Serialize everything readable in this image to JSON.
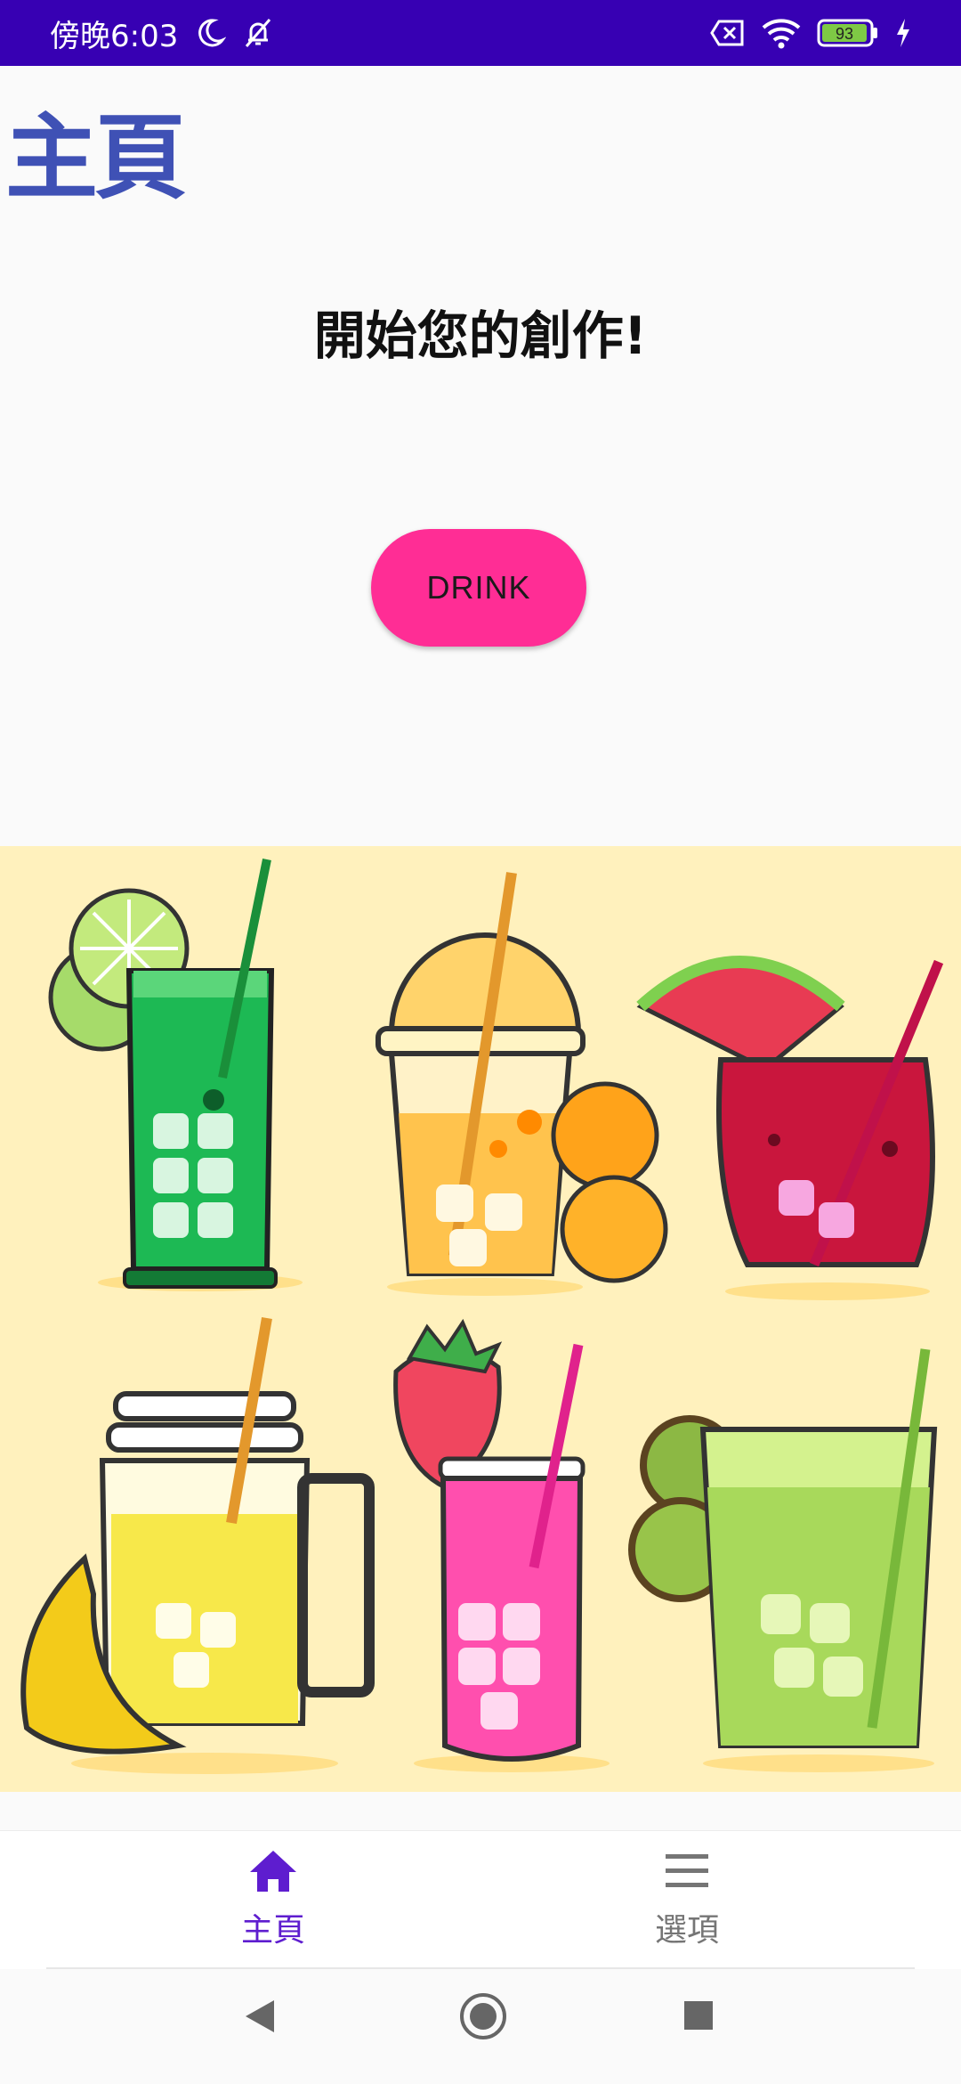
{
  "status_bar": {
    "time": "傍晚6:03",
    "battery": "93",
    "icons": [
      "moon-icon",
      "bell-off-icon",
      "sim-off-icon",
      "wifi-icon",
      "battery-icon",
      "charging-icon"
    ]
  },
  "page": {
    "title": "主頁",
    "headline": "開始您的創作!",
    "button_label": "DRINK"
  },
  "illustration": {
    "name": "drinks-illustration"
  },
  "bottom_nav": {
    "items": [
      {
        "label": "主頁",
        "icon": "home-icon",
        "selected": true
      },
      {
        "label": "選項",
        "icon": "menu-icon",
        "selected": false
      }
    ]
  },
  "system_nav": {
    "icons": [
      "back-icon",
      "home-circle-icon",
      "recents-icon"
    ]
  },
  "colors": {
    "status_bar": "#3700b3",
    "title": "#3f51b5",
    "button": "#ff2d95",
    "nav_selected": "#5e1dcf",
    "nav_unselected": "#757575",
    "illustration_bg": "#fff1bd"
  }
}
